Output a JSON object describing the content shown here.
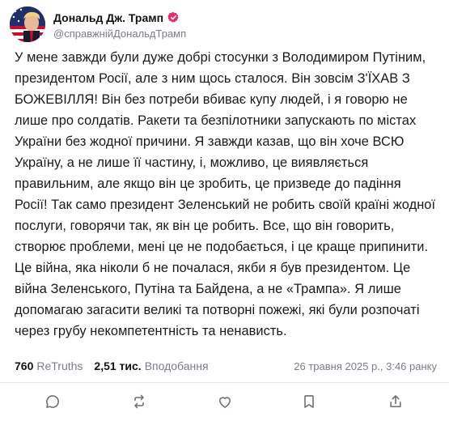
{
  "author": {
    "display_name": "Дональд Дж. Трамп",
    "handle": "@справжнійДональдТрамп",
    "verified_icon": "verified-badge-icon",
    "avatar": "avatar-image"
  },
  "post": {
    "text": "У мене завжди були дуже добрі стосунки з Володимиром Путіним, президентом Росії, але з ним щось сталося. Він зовсім З'ЇХАВ З БОЖЕВІЛЛЯ! Він без потреби вбиває купу людей, і я говорю не лише про солдатів. Ракети та безпілотники запускають по містах України без жодної причини. Я завжди казав, що він хоче ВСЮ Україну, а не лише її частину, і, можливо, це виявляється правильним, але якщо він це зробить, це призведе до падіння Росії! Так само президент Зеленський не робить своїй країні жодної послуги, говорячи так, як він це робить. Все, що він говорить, створює проблеми, мені це не подобається, і це краще припинити. Це війна, яка ніколи б не почалася, якби я був президентом. Це війна Зеленського, Путіна та Байдена, а не «Трампа». Я лише допомагаю загасити великі та потворні пожежі, які були розпочаті через грубу некомпетентність та ненависть."
  },
  "stats": {
    "retruths_count": "760",
    "retruths_label": "ReTruths",
    "likes_count": "2,51 тис.",
    "likes_label": "Вподобання",
    "timestamp": "26 травня 2025 р., 3:46 ранку"
  },
  "actions": [
    {
      "name": "reply-icon"
    },
    {
      "name": "retruth-icon"
    },
    {
      "name": "like-icon"
    },
    {
      "name": "bookmark-icon"
    },
    {
      "name": "share-icon"
    }
  ],
  "colors": {
    "verified": "#e1306c",
    "muted_text": "#7a7d87",
    "icon": "#6b6f7b"
  }
}
